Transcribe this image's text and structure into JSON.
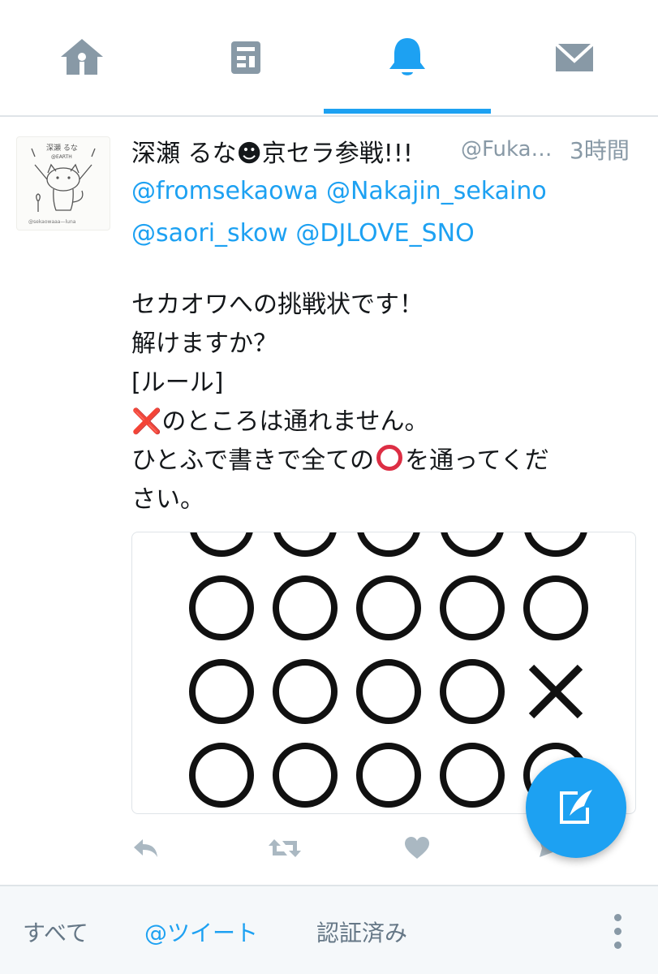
{
  "nav": {
    "tabs": [
      {
        "name": "home",
        "icon": "home-icon",
        "active": false
      },
      {
        "name": "moments",
        "icon": "moments-icon",
        "active": false
      },
      {
        "name": "notifications",
        "icon": "bell-icon",
        "active": true
      },
      {
        "name": "messages",
        "icon": "envelope-icon",
        "active": false
      }
    ],
    "active_color": "#1da1f2",
    "inactive_color": "#8899a6"
  },
  "tweet": {
    "author_name": "深瀬 るな☻京セラ参戦!!!",
    "author_handle": "@Fuka…",
    "time": "3時間",
    "mentions": [
      "@fromsekaowa",
      "@Nakajin_sekaino",
      "@saori_skow",
      "@DJLOVE_SNO"
    ],
    "body": {
      "line1": "セカオワへの挑戦状です！",
      "line2": "解けますか？",
      "line3": "[ルール]",
      "line4_symbol": "❌",
      "line4": "のところは通れません。",
      "line5_before": "ひとふで書きで全ての",
      "line5_after": "を通ってくだ",
      "line6": "さい。"
    },
    "media": {
      "rows": [
        [
          "O",
          "O",
          "O",
          "O",
          "O"
        ],
        [
          "O",
          "O",
          "O",
          "O",
          "O"
        ],
        [
          "O",
          "O",
          "O",
          "O",
          "X"
        ],
        [
          "O",
          "O",
          "O",
          "O",
          "O"
        ]
      ]
    },
    "actions": [
      "reply-icon",
      "retweet-icon",
      "like-icon",
      "dm-icon"
    ]
  },
  "fab": {
    "icon": "compose-tweet-icon"
  },
  "filters": {
    "items": [
      {
        "label": "すべて",
        "active": false
      },
      {
        "label": "@ツイート",
        "active": true
      },
      {
        "label": "認証済み",
        "active": false
      }
    ],
    "menu_icon": "more-vertical-icon"
  }
}
